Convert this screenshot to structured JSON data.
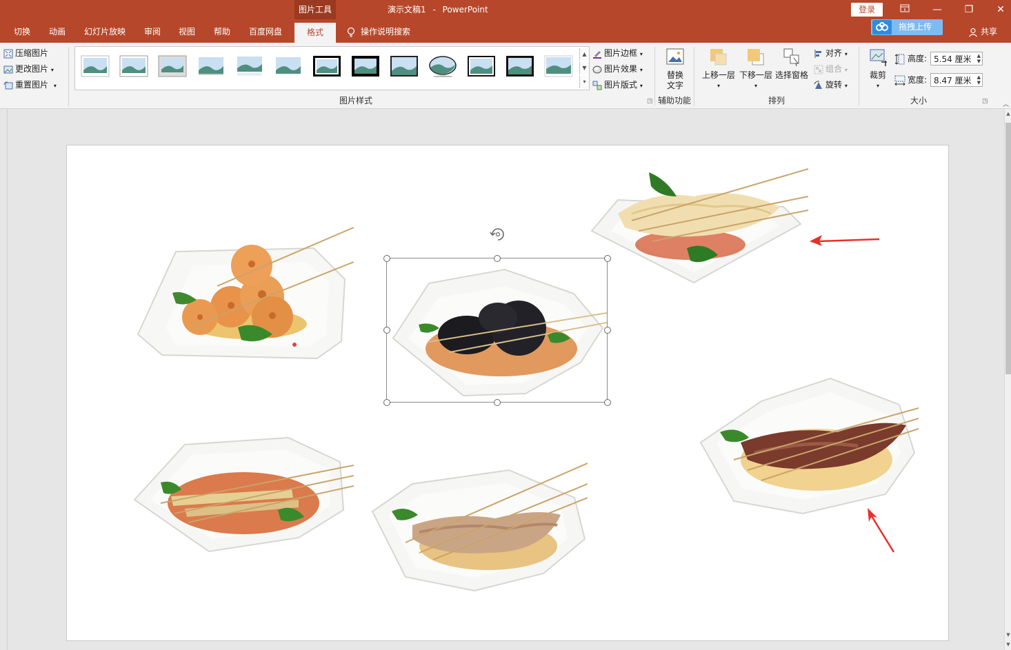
{
  "titlebar": {
    "tool_context": "图片工具",
    "doc_name": "演示文稿1",
    "separator": "-",
    "app_name": "PowerPoint",
    "login": "登录",
    "win_ribbon_icon": "ribbon-display-icon",
    "win_minimize": "—",
    "win_restore": "❐",
    "win_close": "✕"
  },
  "tabs": {
    "items": [
      "切换",
      "动画",
      "幻灯片放映",
      "审阅",
      "视图",
      "帮助",
      "百度网盘"
    ],
    "active": "格式",
    "tell_me": "操作说明搜索",
    "upload": "拖拽上传",
    "share": "共享"
  },
  "ribbon": {
    "adjust": {
      "compress": "压缩图片",
      "change": "更改图片",
      "reset": "重置图片"
    },
    "picture_styles": {
      "label": "图片样式",
      "border": "图片边框",
      "effects": "图片效果",
      "layout": "图片版式"
    },
    "accessibility": {
      "alt_text_line1": "替换",
      "alt_text_line2": "文字",
      "label": "辅助功能"
    },
    "arrange": {
      "bring_forward": "上移一层",
      "send_backward": "下移一层",
      "selection_pane": "选择窗格",
      "align": "对齐",
      "group": "组合",
      "rotate": "旋转",
      "label": "排列"
    },
    "size": {
      "crop": "裁剪",
      "height_label": "高度:",
      "height_value": "5.54 厘米",
      "width_label": "宽度:",
      "width_value": "8.47 厘米",
      "label": "大小"
    }
  },
  "slide": {
    "images": [
      "lotus-root-skewers-dish",
      "wood-ear-mushroom-skewers-dish",
      "tofu-skin-skewers-dish",
      "bamboo-shoot-skewers-dish",
      "tripe-skewers-dish",
      "gizzard-skewers-dish"
    ],
    "annotations": [
      "red-arrow",
      "red-arrow"
    ]
  },
  "colors": {
    "accent": "#b7472a",
    "ribbon_bg": "#f3f3f3",
    "workspace_bg": "#e6e6e6",
    "annotation_red": "#e8302a"
  }
}
